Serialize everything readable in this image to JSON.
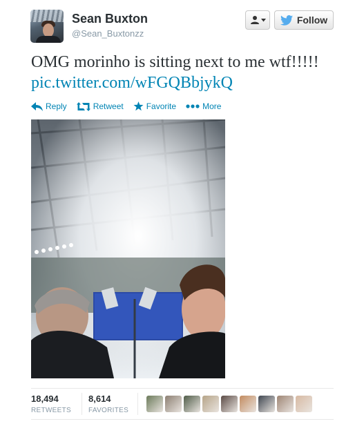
{
  "user": {
    "name": "Sean Buxton",
    "handle": "@Sean_Buxtonzz"
  },
  "buttons": {
    "follow_label": "Follow"
  },
  "tweet": {
    "text": "OMG morinho is sitting next to me wtf!!!!!",
    "link": "pic.twitter.com/wFGQBbjykQ"
  },
  "actions": {
    "reply": "Reply",
    "retweet": "Retweet",
    "favorite": "Favorite",
    "more": "More"
  },
  "stats": {
    "retweets_count": "18,494",
    "retweets_label": "RETWEETS",
    "favorites_count": "8,614",
    "favorites_label": "FAVORITES"
  },
  "colors": {
    "link": "#0084b4",
    "twitter_blue": "#55acee",
    "muted": "#8899a6"
  },
  "icons": {
    "reply": "reply-arrow-icon",
    "retweet": "retweet-icon",
    "favorite": "star-icon",
    "more": "ellipsis-icon",
    "user_menu": "person-icon",
    "follow": "twitter-bird-icon"
  },
  "favoriters": [
    {
      "color": "#6b7a5a"
    },
    {
      "color": "#8c7f72"
    },
    {
      "color": "#4f5c48"
    },
    {
      "color": "#b6a488"
    },
    {
      "color": "#5a4a45"
    },
    {
      "color": "#c28b5f"
    },
    {
      "color": "#3f4650"
    },
    {
      "color": "#9e8574"
    },
    {
      "color": "#d7b9a2"
    }
  ]
}
